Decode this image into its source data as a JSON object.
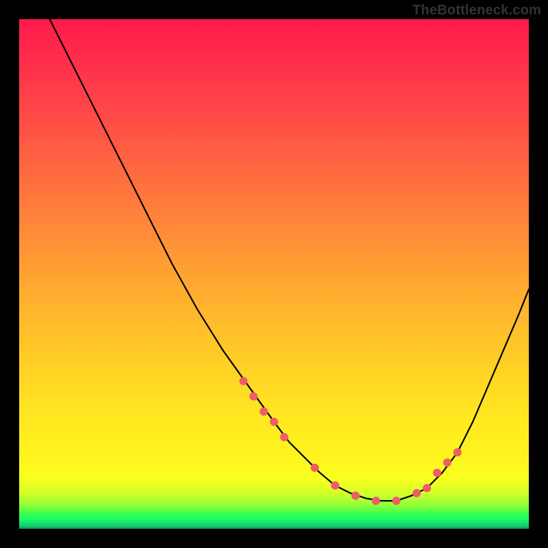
{
  "watermark": "TheBottleneck.com",
  "chart_data": {
    "type": "line",
    "title": "",
    "xlabel": "",
    "ylabel": "",
    "xlim": [
      0,
      100
    ],
    "ylim": [
      0,
      100
    ],
    "grid": false,
    "legend": false,
    "series": [
      {
        "name": "bottleneck-curve",
        "x": [
          6,
          10,
          15,
          20,
          25,
          30,
          35,
          40,
          45,
          50,
          53,
          56,
          59,
          62,
          65,
          68,
          71,
          74,
          77,
          80,
          83,
          86,
          89,
          92,
          95,
          98,
          100
        ],
        "y": [
          100,
          92,
          82,
          72,
          62,
          52,
          43,
          35,
          28,
          21,
          17,
          14,
          11,
          8.5,
          7,
          6,
          5.5,
          5.5,
          6.5,
          8,
          11,
          15,
          21,
          28,
          35,
          42,
          47
        ]
      }
    ],
    "markers": {
      "name": "highlight-dots",
      "x": [
        44,
        46,
        48,
        50,
        52,
        58,
        62,
        66,
        70,
        74,
        78,
        80,
        82,
        84,
        86
      ],
      "y": [
        29,
        26,
        23,
        21,
        18,
        12,
        8.5,
        6.5,
        5.5,
        5.5,
        7,
        8,
        11,
        13,
        15
      ]
    },
    "background_gradient": {
      "top": "#ff1a4d",
      "mid": "#ffe820",
      "bottom": "#14c96e"
    }
  }
}
